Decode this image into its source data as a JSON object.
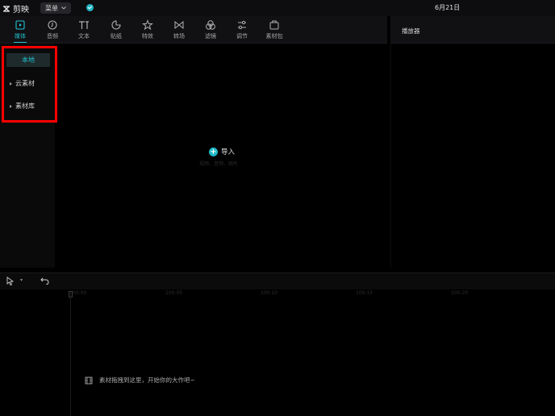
{
  "app": {
    "name": "剪映",
    "menu_label": "菜单",
    "date": "6月21日"
  },
  "toolbar": {
    "tools": [
      {
        "label": "媒体",
        "icon": "media-icon",
        "active": true
      },
      {
        "label": "音频",
        "icon": "audio-icon"
      },
      {
        "label": "文本",
        "icon": "text-icon"
      },
      {
        "label": "贴纸",
        "icon": "sticker-icon"
      },
      {
        "label": "特效",
        "icon": "effects-icon"
      },
      {
        "label": "转场",
        "icon": "transition-icon"
      },
      {
        "label": "滤镜",
        "icon": "filter-icon"
      },
      {
        "label": "调节",
        "icon": "adjust-icon"
      },
      {
        "label": "素材包",
        "icon": "package-icon"
      }
    ]
  },
  "player": {
    "title": "播放器"
  },
  "sidebar": {
    "items": [
      {
        "label": "本地",
        "active": true
      },
      {
        "label": "云素材"
      },
      {
        "label": "素材库"
      }
    ]
  },
  "media": {
    "import_label": "导入",
    "import_hint": "视频、音频、图片"
  },
  "timeline": {
    "ticks": [
      "00:00",
      "100:05",
      "100:10",
      "100:15",
      "100:20"
    ],
    "empty_hint": "素材拖拽到这里，开始你的大作吧~"
  },
  "colors": {
    "accent": "#22c2d0",
    "highlight": "#ff0000"
  }
}
